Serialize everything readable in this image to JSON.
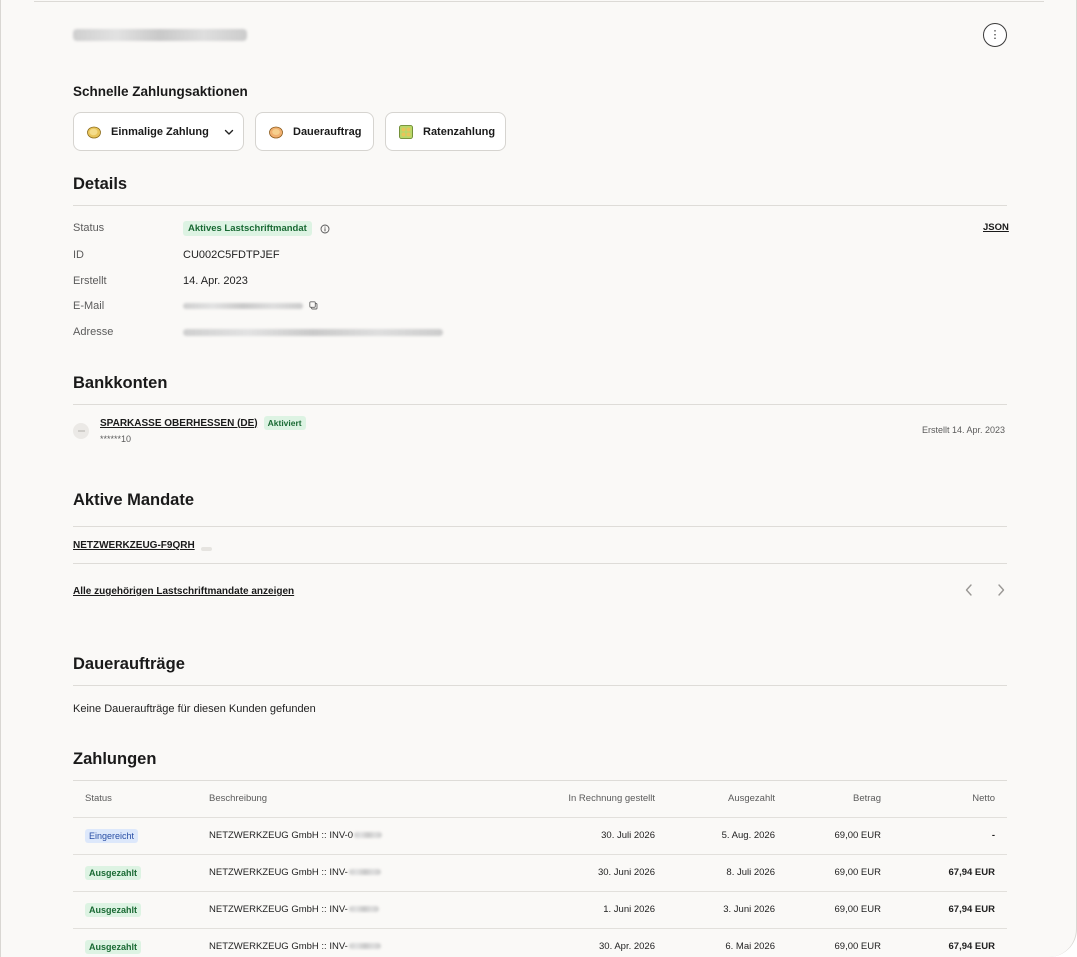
{
  "header": {
    "more_icon": "more-vertical-icon"
  },
  "quick_actions": {
    "title": "Schnelle Zahlungsaktionen",
    "buttons": [
      {
        "label": "Einmalige Zahlung",
        "icon": "coin-icon"
      },
      {
        "label": "Dauerauftrag",
        "icon": "recurring-coin-icon"
      },
      {
        "label": "Ratenzahlung",
        "icon": "installment-icon"
      }
    ]
  },
  "details": {
    "title": "Details",
    "json_link": "JSON",
    "status_label": "Status",
    "status_value": "Aktives Lastschriftmandat",
    "id_label": "ID",
    "id_value": "CU002C5FDTPJEF",
    "created_label": "Erstellt",
    "created_value": "14. Apr. 2023",
    "email_label": "E-Mail",
    "address_label": "Adresse"
  },
  "bank_accounts": {
    "title": "Bankkonten",
    "name": "SPARKASSE OBERHESSEN (DE)",
    "badge": "Aktiviert",
    "number": "******10",
    "created": "Erstellt 14. Apr. 2023"
  },
  "mandates": {
    "title": "Aktive Mandate",
    "item": "NETZWERKZEUG-F9QRH",
    "show_all": "Alle zugehörigen Lastschriftmandate anzeigen"
  },
  "standing_orders": {
    "title": "Daueraufträge",
    "empty": "Keine Daueraufträge für diesen Kunden gefunden"
  },
  "payments": {
    "title": "Zahlungen",
    "columns": [
      "Status",
      "Beschreibung",
      "In Rechnung gestellt",
      "Ausgezahlt",
      "Betrag",
      "Netto"
    ],
    "rows": [
      {
        "status": "Eingereicht",
        "status_color": "#dde8fb",
        "description": "NETZWERKZEUG GmbH :: INV-0",
        "invoiced": "30. Juli 2026",
        "paid_out": "5. Aug. 2026",
        "amount": "69,00 EUR",
        "net": "-"
      },
      {
        "status": "Ausgezahlt",
        "status_color": "#ddf3e3",
        "description": "NETZWERKZEUG GmbH :: INV-",
        "invoiced": "30. Juni 2026",
        "paid_out": "8. Juli 2026",
        "amount": "69,00 EUR",
        "net": "67,94 EUR"
      },
      {
        "status": "Ausgezahlt",
        "status_color": "#ddf3e3",
        "description": "NETZWERKZEUG GmbH :: INV-",
        "invoiced": "1. Juni 2026",
        "paid_out": "3. Juni 2026",
        "amount": "69,00 EUR",
        "net": "67,94 EUR"
      },
      {
        "status": "Ausgezahlt",
        "status_color": "#ddf3e3",
        "description": "NETZWERKZEUG GmbH :: INV-",
        "invoiced": "30. Apr. 2026",
        "paid_out": "6. Mai 2026",
        "amount": "69,00 EUR",
        "net": "67,94 EUR"
      }
    ]
  }
}
